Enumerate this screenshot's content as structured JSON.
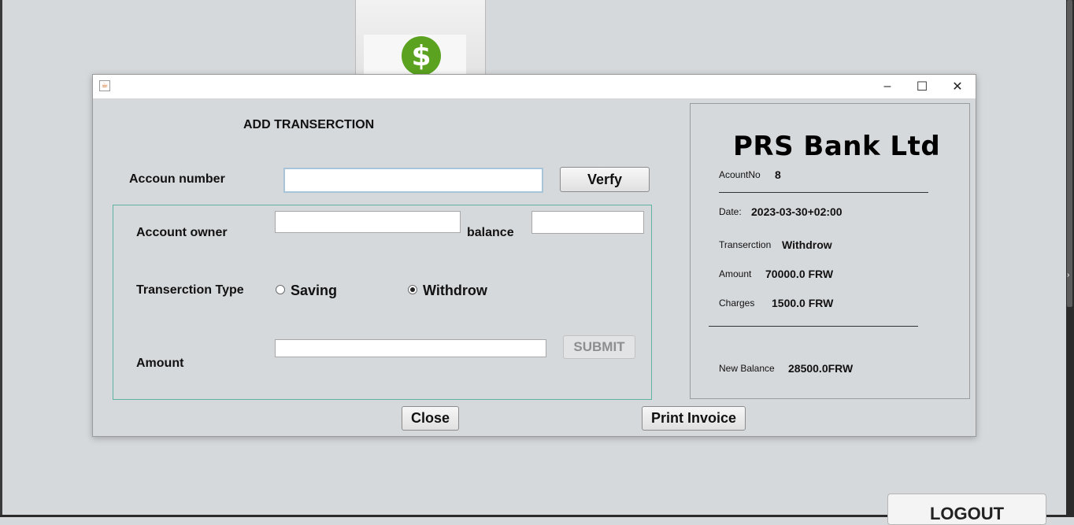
{
  "background": {
    "logout_label": "LOGOUT",
    "logo_symbol": "$"
  },
  "dialog": {
    "window_controls": {
      "minimize": "–",
      "maximize": "☐",
      "close": "✕"
    },
    "form": {
      "title": "ADD TRANSERCTION",
      "account_number_label": "Accoun number",
      "account_number_value": "",
      "verify_label": "Verfy",
      "account_owner_label": "Account owner",
      "account_owner_value": "",
      "balance_label": "balance",
      "balance_value": "",
      "type_label": "Transerction Type",
      "type_options": [
        "Saving",
        "Withdrow"
      ],
      "type_selected": "Withdrow",
      "amount_label": "Amount",
      "amount_value": "",
      "submit_label": "SUBMIT",
      "close_label": "Close",
      "print_label": "Print Invoice"
    },
    "receipt": {
      "bank_name": "PRS Bank Ltd",
      "account_no_label": "AcountNo",
      "account_no_value": "8",
      "date_label": "Date:",
      "date_value": "2023-03-30+02:00",
      "transaction_label": "Transerction",
      "transaction_value": "Withdrow",
      "amount_label": "Amount",
      "amount_value": "70000.0 FRW",
      "charges_label": "Charges",
      "charges_value": "1500.0 FRW",
      "new_balance_label": "New Balance",
      "new_balance_value": "28500.0FRW"
    }
  },
  "colors": {
    "desktop_bg": "#d6d9dc",
    "panel_border_accent": "#5fb3a3",
    "logo_green": "#5aa21f"
  }
}
